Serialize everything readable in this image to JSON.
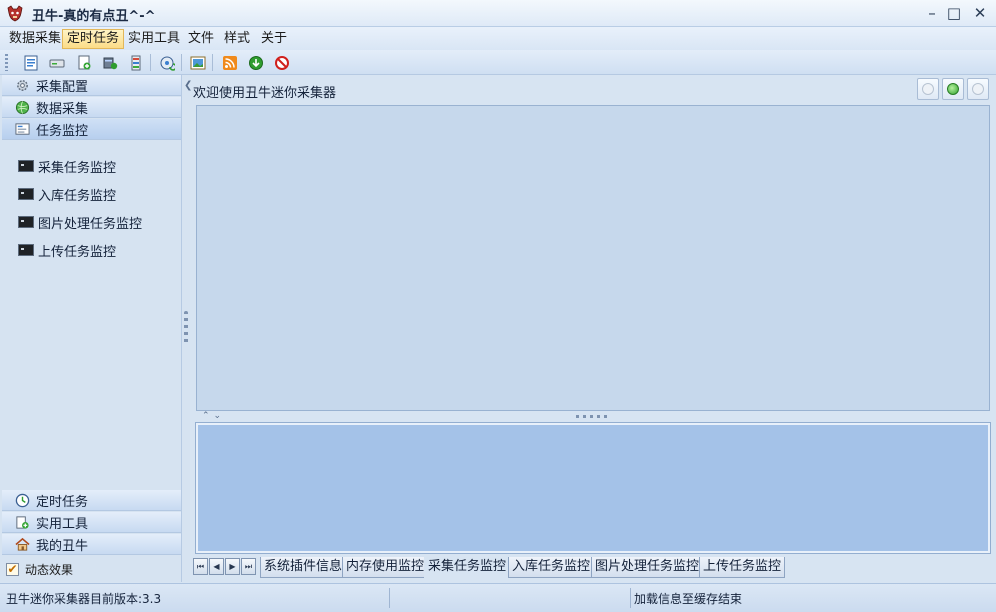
{
  "window": {
    "title": "丑牛-真的有点丑^-^",
    "minimize": "–",
    "maximize": "□",
    "close": "✕"
  },
  "menu": [
    {
      "label": "数据采集",
      "active": false
    },
    {
      "label": "定时任务",
      "active": true
    },
    {
      "label": "实用工具",
      "active": false
    },
    {
      "label": "文件",
      "active": false
    },
    {
      "label": "样式",
      "active": false
    },
    {
      "label": "关于",
      "active": false
    }
  ],
  "toolbar_icons": [
    "page-icon",
    "drive-icon",
    "add-page-icon",
    "server-icon",
    "db-icon",
    "refresh-disc-icon",
    "image-icon",
    "rss-icon",
    "download-icon",
    "stop-icon"
  ],
  "sidebar": {
    "sections": [
      {
        "label": "采集配置",
        "icon": "gear-icon"
      },
      {
        "label": "数据采集",
        "icon": "globe-icon"
      },
      {
        "label": "任务监控",
        "icon": "monitor-icon"
      }
    ],
    "tasks": [
      "采集任务监控",
      "入库任务监控",
      "图片处理任务监控",
      "上传任务监控"
    ],
    "bottom_sections": [
      {
        "label": "定时任务",
        "icon": "clock-icon"
      },
      {
        "label": "实用工具",
        "icon": "tools-icon"
      },
      {
        "label": "我的丑牛",
        "icon": "home-icon"
      }
    ],
    "effect_label": "动态效果",
    "effect_checked": true
  },
  "main": {
    "welcome": "欢迎使用丑牛迷你采集器"
  },
  "tabs": [
    {
      "label": "系统插件信息",
      "active": false
    },
    {
      "label": "内存使用监控",
      "active": false
    },
    {
      "label": "采集任务监控",
      "active": true
    },
    {
      "label": "入库任务监控",
      "active": false
    },
    {
      "label": "图片处理任务监控",
      "active": false
    },
    {
      "label": "上传任务监控",
      "active": false
    }
  ],
  "tab_nav": [
    "⏮",
    "◀",
    "▶",
    "⏭"
  ],
  "status": {
    "version": "丑牛迷你采集器目前版本:3.3",
    "message": "加载信息至缓存结束"
  }
}
